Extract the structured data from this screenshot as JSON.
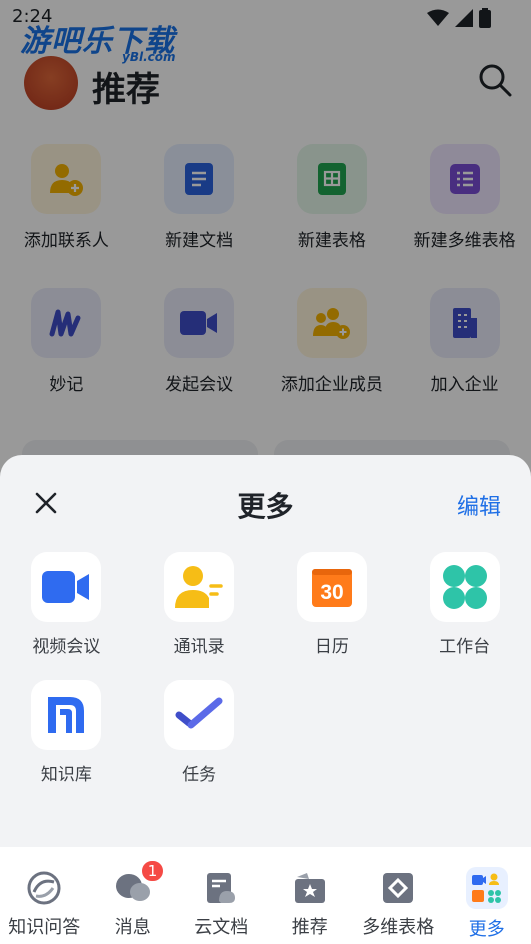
{
  "status_bar": {
    "time": "2:24"
  },
  "watermark": {
    "brand": "游吧乐下载",
    "domain": "yBl.com"
  },
  "header": {
    "title": "推荐"
  },
  "shortcuts": {
    "row1": [
      {
        "label": "添加联系人",
        "icon": "add-contact-icon"
      },
      {
        "label": "新建文档",
        "icon": "doc-icon"
      },
      {
        "label": "新建表格",
        "icon": "sheet-icon"
      },
      {
        "label": "新建多维表格",
        "icon": "base-icon"
      }
    ],
    "row2": [
      {
        "label": "妙记",
        "icon": "minutes-icon"
      },
      {
        "label": "发起会议",
        "icon": "video-icon"
      },
      {
        "label": "添加企业成员",
        "icon": "add-member-icon"
      },
      {
        "label": "加入企业",
        "icon": "building-icon"
      }
    ]
  },
  "sheet": {
    "title": "更多",
    "edit_label": "编辑",
    "apps": [
      {
        "label": "视频会议",
        "icon": "video-call-icon"
      },
      {
        "label": "通讯录",
        "icon": "contacts-icon"
      },
      {
        "label": "日历",
        "icon": "calendar-icon",
        "day": "30"
      },
      {
        "label": "工作台",
        "icon": "workplace-icon"
      },
      {
        "label": "知识库",
        "icon": "wiki-icon"
      },
      {
        "label": "任务",
        "icon": "tasks-icon"
      }
    ]
  },
  "tabbar": {
    "tabs": [
      {
        "label": "知识问答",
        "icon": "ai-qa-icon"
      },
      {
        "label": "消息",
        "icon": "messages-icon",
        "badge": "1"
      },
      {
        "label": "云文档",
        "icon": "cloud-docs-icon"
      },
      {
        "label": "推荐",
        "icon": "recommend-icon"
      },
      {
        "label": "多维表格",
        "icon": "bitable-icon"
      },
      {
        "label": "更多",
        "icon": "more-apps-icon",
        "active": true
      }
    ]
  },
  "colors": {
    "accent": "#1f6fe6",
    "badge": "#f54a45",
    "sheet_bg": "#f2f3f5"
  }
}
